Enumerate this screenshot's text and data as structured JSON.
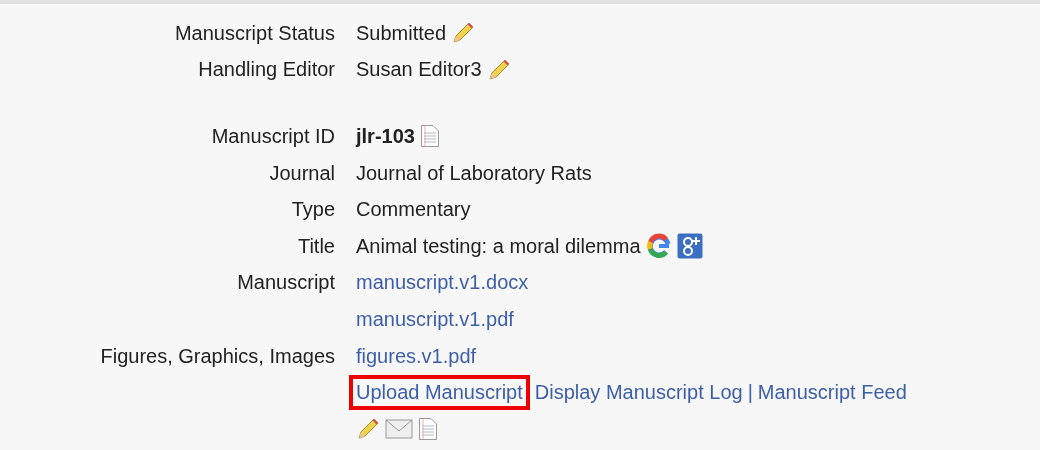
{
  "rows": [
    {
      "label": "Manuscript Status",
      "values": [
        {
          "kind": "text",
          "text": "Submitted",
          "icons": [
            {
              "kind": "pencil"
            }
          ]
        }
      ]
    },
    {
      "label": "Handling Editor",
      "values": [
        {
          "kind": "text",
          "text": "Susan Editor3",
          "icons": [
            {
              "kind": "pencil"
            }
          ]
        }
      ]
    },
    {
      "kind": "spacer"
    },
    {
      "label": "Manuscript ID",
      "values": [
        {
          "kind": "bold",
          "text": "jlr-103",
          "icons": [
            {
              "kind": "document"
            }
          ]
        }
      ]
    },
    {
      "label": "Journal",
      "values": [
        {
          "kind": "text",
          "text": "Journal of Laboratory Rats"
        }
      ]
    },
    {
      "label": "Type",
      "values": [
        {
          "kind": "text",
          "text": "Commentary"
        }
      ]
    },
    {
      "label": "Title",
      "values": [
        {
          "kind": "text",
          "text": "Animal testing: a moral dilemma",
          "icons": [
            {
              "kind": "google"
            },
            {
              "kind": "google-plus"
            }
          ]
        }
      ]
    },
    {
      "label": "Manuscript",
      "values": [
        {
          "kind": "link",
          "text": "manuscript.v1.docx"
        }
      ]
    },
    {
      "values": [
        {
          "kind": "link",
          "text": "manuscript.v1.pdf"
        }
      ]
    },
    {
      "label": "Figures, Graphics, Images",
      "values": [
        {
          "kind": "link",
          "text": "figures.v1.pdf"
        }
      ]
    },
    {
      "values": [
        {
          "kind": "link",
          "text": "Upload Manuscript",
          "highlighted": true
        },
        {
          "kind": "link",
          "text": "Display Manuscript Log"
        },
        {
          "kind": "separator",
          "text": "|"
        },
        {
          "kind": "link",
          "text": "Manuscript Feed"
        }
      ]
    },
    {
      "values": [
        {
          "kind": "icons",
          "icons": [
            {
              "kind": "pencil"
            },
            {
              "kind": "envelope"
            },
            {
              "kind": "document"
            }
          ]
        }
      ]
    }
  ]
}
